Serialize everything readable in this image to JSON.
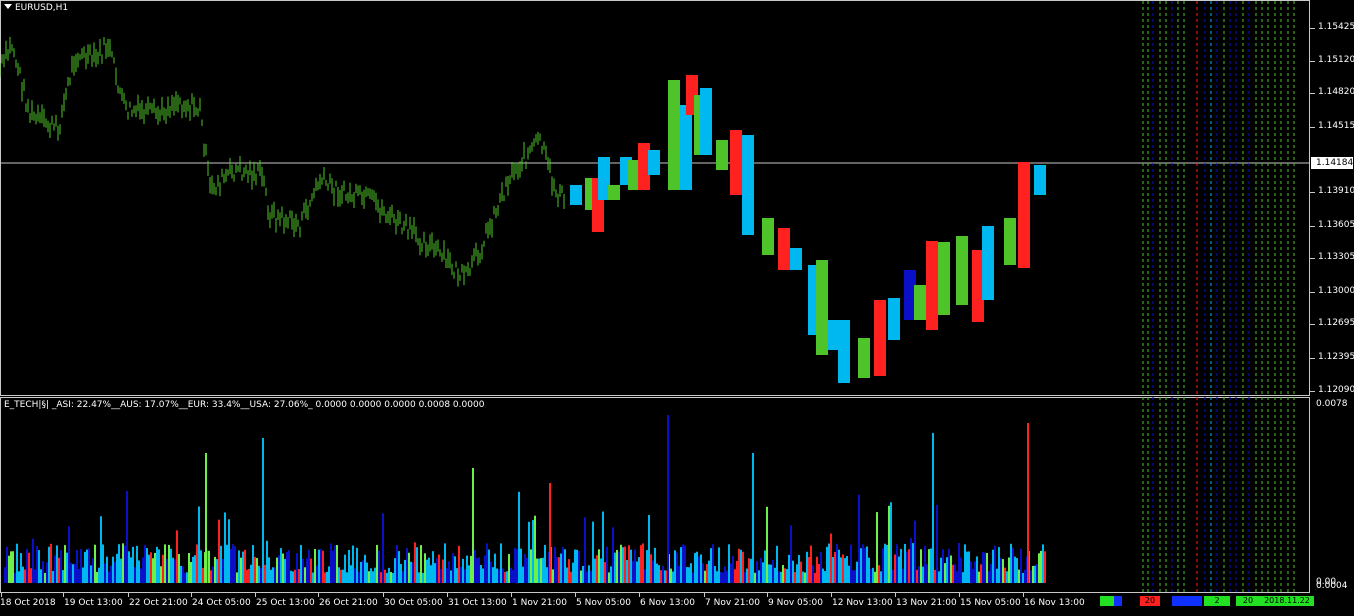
{
  "chart": {
    "symbol_timeframe": "EURUSD,H1",
    "current_price": "1.14184",
    "price_axis": [
      "1.15425",
      "1.15120",
      "1.14820",
      "1.14515",
      "1.13910",
      "1.13605",
      "1.13305",
      "1.13000",
      "1.12695",
      "1.12395",
      "1.12090"
    ],
    "time_axis": [
      "18 Oct 2018",
      "19 Oct 13:00",
      "22 Oct 21:00",
      "24 Oct 05:00",
      "25 Oct 13:00",
      "26 Oct 21:00",
      "30 Oct 05:00",
      "31 Oct 13:00",
      "1 Nov 21:00",
      "5 Nov 05:00",
      "6 Nov 13:00",
      "7 Nov 21:00",
      "9 Nov 05:00",
      "12 Nov 13:00",
      "13 Nov 21:00",
      "15 Nov 05:00",
      "16 Nov 13:00"
    ],
    "colors": {
      "background": "#000000",
      "bars": "#4ec32a",
      "up": "#6ef04a",
      "down": "#ff2020",
      "neutral": "#00b8f0",
      "deep": "#0a10c8",
      "pink": "#ffb0c8",
      "grid": "#c8c8c8"
    }
  },
  "indicator": {
    "title": "E_TECH|§| _ASI: 22.47%__AUS: 17.07%__EUR: 33.4%__USA: 27.06%_ 0.0000 0.0000 0.0000 0.0008 0.0000",
    "scale_top": "0.0078",
    "scale_bottom": "0.00",
    "scale_bottom2": "0.0004"
  },
  "status": {
    "cells": [
      "20",
      "2",
      "20",
      "2018.11.22 13:00"
    ]
  }
}
